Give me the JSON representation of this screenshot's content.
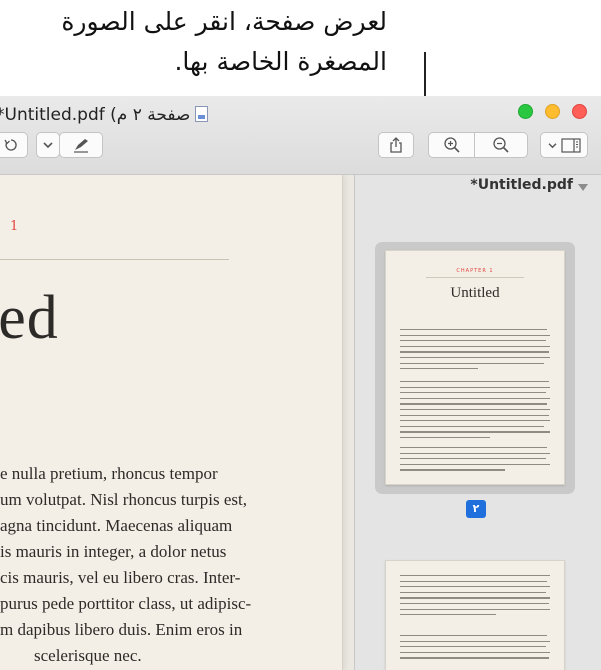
{
  "callout": {
    "line1": "لعرض صفحة، انقر على الصورة",
    "line2": "المصغرة الخاصة بها."
  },
  "window": {
    "title": "*Untitled.pdf (صفحة ٢ م",
    "icons": [
      "document-icon",
      "rotate-icon",
      "chevron-down-icon",
      "markup-pen-icon",
      "share-icon",
      "zoom-in-icon",
      "zoom-out-icon",
      "sidebar-icon"
    ]
  },
  "page": {
    "chapter_number": "1",
    "title": "led",
    "lines": [
      "e nulla pretium, rhoncus tempor",
      "um volutpat. Nisl rhoncus turpis est,",
      "agna tincidunt. Maecenas aliquam",
      "is mauris in integer, a dolor netus",
      "cis mauris, vel eu libero cras. Inter-",
      " purus pede porttitor class, ut adipisc-",
      "m dapibus libero duis. Enim eros in",
      "scelerisque nec."
    ]
  },
  "sidebar": {
    "title": "*Untitled.pdf",
    "thumbnail": {
      "chapter": "CHAPTER 1",
      "title": "Untitled"
    },
    "selected_page_badge": "٢"
  },
  "colors": {
    "accent": "#1f6fdc",
    "chapter_red": "#e1453f",
    "page_bg": "#f4efe6"
  }
}
